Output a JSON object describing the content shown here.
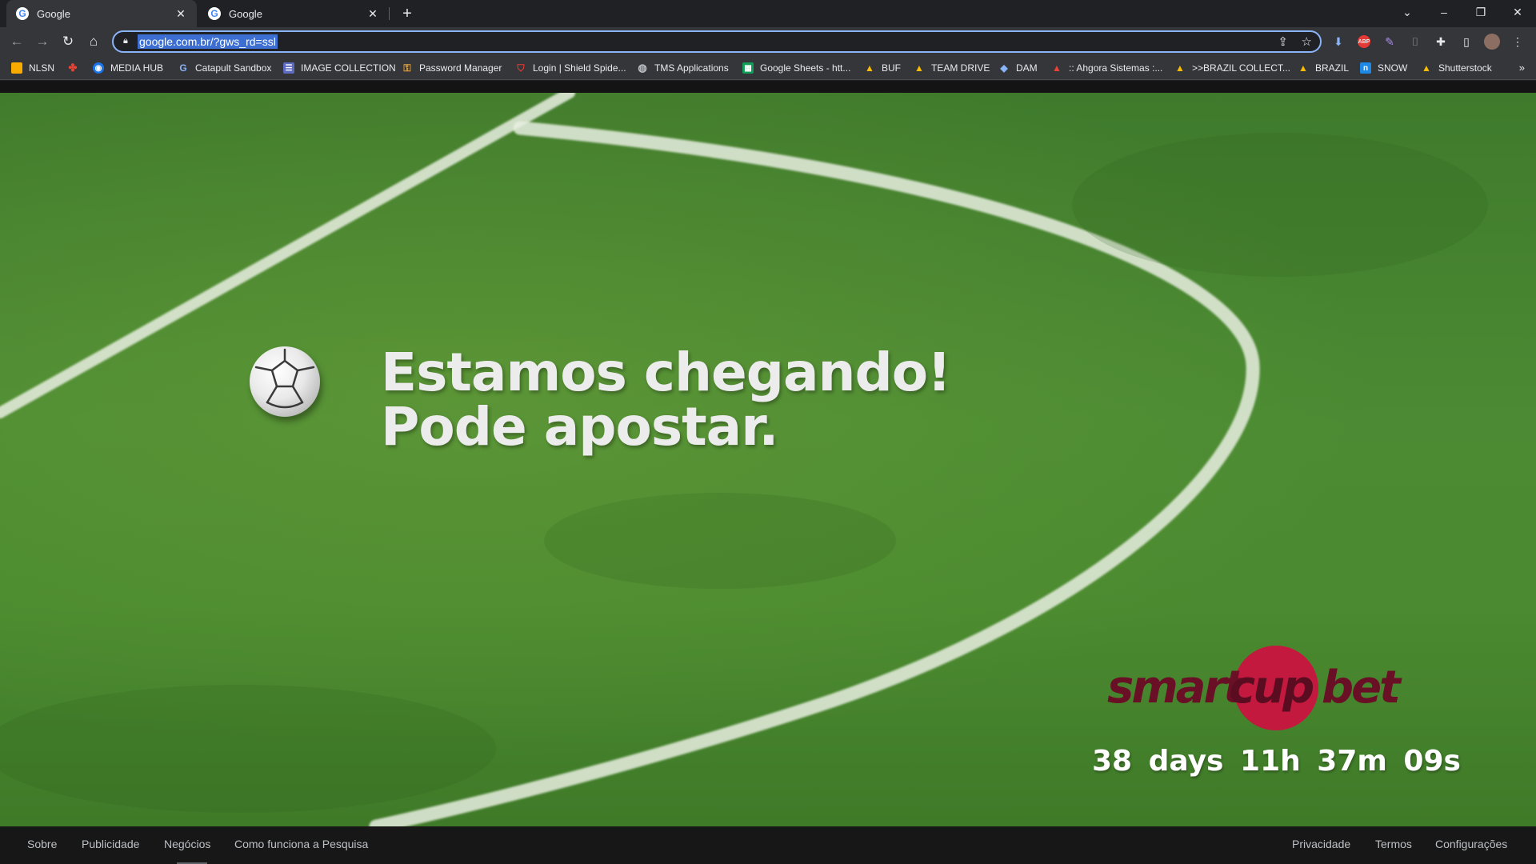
{
  "tabs": [
    {
      "label": "Google",
      "active": true
    },
    {
      "label": "Google",
      "active": false
    }
  ],
  "omnibox": {
    "url": "google.com.br/?gws_rd=ssl"
  },
  "bookmarks": [
    {
      "label": "NLSN",
      "icon": "folder-icon",
      "color": "#f9ab00"
    },
    {
      "label": "",
      "icon": "pinwheel-icon",
      "color": "#ea4335"
    },
    {
      "label": "MEDIA HUB",
      "icon": "media-hub-icon",
      "color": "#1a73e8"
    },
    {
      "label": "Catapult Sandbox",
      "icon": "google-g-icon",
      "color": "#4285f4"
    },
    {
      "label": "IMAGE COLLECTION",
      "icon": "list-icon",
      "color": "#5c6bc0"
    },
    {
      "label": "Password Manager",
      "icon": "key-icon",
      "color": "#e8a33d"
    },
    {
      "label": "Login | Shield Spide...",
      "icon": "shield-icon",
      "color": "#e53935"
    },
    {
      "label": "TMS Applications",
      "icon": "globe-icon",
      "color": "#9aa0a6"
    },
    {
      "label": "Google Sheets - htt...",
      "icon": "sheets-icon",
      "color": "#0f9d58"
    },
    {
      "label": "BUF",
      "icon": "drive-icon",
      "color": "#fbbc04"
    },
    {
      "label": "TEAM DRIVE",
      "icon": "drive-icon",
      "color": "#fbbc04"
    },
    {
      "label": "DAM",
      "icon": "dam-icon",
      "color": "#4285f4"
    },
    {
      "label": ":: Ahgora Sistemas :...",
      "icon": "ahgora-icon",
      "color": "#ea4335"
    },
    {
      "label": ">>BRAZIL COLLECT...",
      "icon": "drive-icon",
      "color": "#fbbc04"
    },
    {
      "label": "BRAZIL",
      "icon": "drive-icon",
      "color": "#fbbc04"
    },
    {
      "label": "SNOW",
      "icon": "snow-icon",
      "color": "#1e88e5"
    },
    {
      "label": "Shutterstock",
      "icon": "drive-icon",
      "color": "#fbbc04"
    }
  ],
  "hero": {
    "headline_line1": "Estamos chegando!",
    "headline_line2": "Pode apostar.",
    "logo_part1": "smart",
    "logo_part2": "cup",
    "logo_part3": "bet",
    "countdown": "38 days  11h  37m  09s"
  },
  "footer": {
    "left": [
      "Sobre",
      "Publicidade",
      "Negócios",
      "Como funciona a Pesquisa"
    ],
    "right": [
      "Privacidade",
      "Termos",
      "Configurações"
    ]
  }
}
